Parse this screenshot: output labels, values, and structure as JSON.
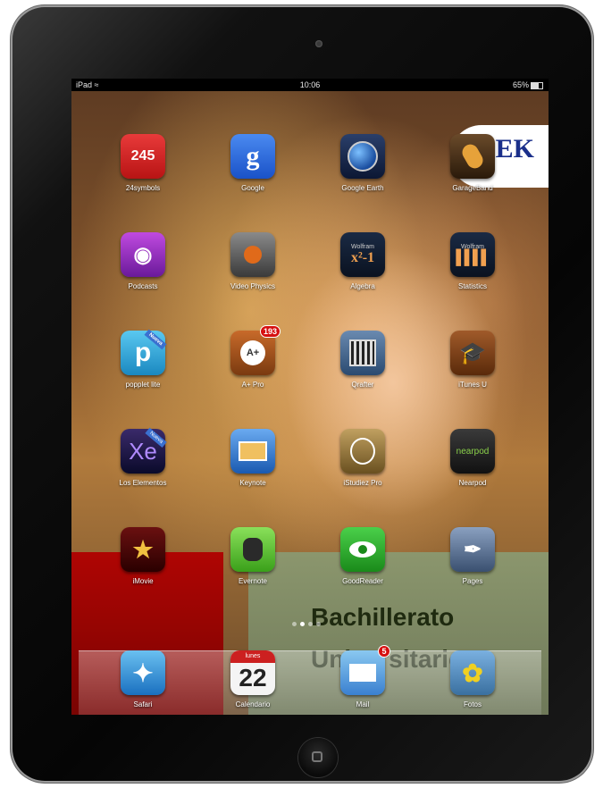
{
  "status_bar": {
    "device": "iPad",
    "time": "10:06",
    "battery": "65%"
  },
  "banner": {
    "line1": "Bachillerato",
    "line2": "Universitario"
  },
  "home_rows": [
    [
      {
        "label": "24symbols",
        "icon_text": "245"
      },
      {
        "label": "Google",
        "icon_text": "g"
      },
      {
        "label": "Google Earth",
        "icon_text": ""
      },
      {
        "label": "GarageBand",
        "icon_text": ""
      }
    ],
    [
      {
        "label": "Podcasts",
        "icon_text": ""
      },
      {
        "label": "Video Physics",
        "icon_text": ""
      },
      {
        "label": "Algebra",
        "icon_text": "x²-1"
      },
      {
        "label": "Statistics",
        "icon_text": ""
      }
    ],
    [
      {
        "label": "popplet lite",
        "icon_text": "p"
      },
      {
        "label": "A+ Pro",
        "icon_text": "A+",
        "badge": "193"
      },
      {
        "label": "Qrafter",
        "icon_text": ""
      },
      {
        "label": "iTunes U",
        "icon_text": ""
      }
    ],
    [
      {
        "label": "Los Elementos",
        "icon_text": "Xe"
      },
      {
        "label": "Keynote",
        "icon_text": ""
      },
      {
        "label": "iStudiez Pro",
        "icon_text": ""
      },
      {
        "label": "Nearpod",
        "icon_text": "nearpod"
      }
    ],
    [
      {
        "label": "iMovie",
        "icon_text": "★"
      },
      {
        "label": "Evernote",
        "icon_text": ""
      },
      {
        "label": "GoodReader",
        "icon_text": ""
      },
      {
        "label": "Pages",
        "icon_text": ""
      }
    ]
  ],
  "ribbons": {
    "popplet": "Nueva",
    "elementos": "Nueva"
  },
  "wolfram": "Wolfram",
  "dock": [
    {
      "label": "Safari"
    },
    {
      "label": "Calendario",
      "day": "lunes",
      "date": "22"
    },
    {
      "label": "Mail",
      "badge": "5"
    },
    {
      "label": "Fotos"
    }
  ],
  "colors": {
    "badge": "#d61010",
    "red_panel": "#b00000",
    "green_panel": "#8a9a72",
    "banner_text": "#1f2a10"
  }
}
